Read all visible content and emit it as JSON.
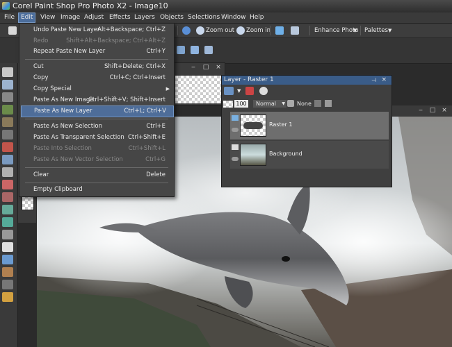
{
  "window": {
    "title": "Corel Paint Shop Pro Photo X2 - Image10"
  },
  "menubar": [
    "File",
    "Edit",
    "View",
    "Image",
    "Adjust",
    "Effects",
    "Layers",
    "Objects",
    "Selections",
    "Window",
    "Help"
  ],
  "toolbar": {
    "zoom_out": "Zoom out",
    "zoom_in": "Zoom in",
    "enhance_photo": "Enhance Photo",
    "palettes": "Palettes"
  },
  "edit_menu": {
    "items": [
      {
        "label": "Undo Paste New Layer",
        "shortcut": "Alt+Backspace; Ctrl+Z"
      },
      {
        "label": "Redo",
        "shortcut": "Shift+Alt+Backspace; Ctrl+Alt+Z"
      },
      {
        "label": "Repeat  Paste New Layer",
        "shortcut": "Ctrl+Y"
      },
      {
        "label": "Cut",
        "shortcut": "Shift+Delete; Ctrl+X"
      },
      {
        "label": "Copy",
        "shortcut": "Ctrl+C; Ctrl+Insert"
      },
      {
        "label": "Copy Special",
        "shortcut": ""
      },
      {
        "label": "Paste As New Image",
        "shortcut": "Ctrl+Shift+V; Shift+Insert"
      },
      {
        "label": "Paste As New Layer",
        "shortcut": "Ctrl+L; Ctrl+V"
      },
      {
        "label": "Paste As New Selection",
        "shortcut": "Ctrl+E"
      },
      {
        "label": "Paste As Transparent Selection",
        "shortcut": "Ctrl+Shift+E"
      },
      {
        "label": "Paste Into Selection",
        "shortcut": "Ctrl+Shift+L"
      },
      {
        "label": "Paste As New Vector Selection",
        "shortcut": "Ctrl+G"
      },
      {
        "label": "Clear",
        "shortcut": "Delete"
      },
      {
        "label": "Empty Clipboard",
        "shortcut": ""
      }
    ]
  },
  "layers_palette": {
    "title": "Layer - Raster 1",
    "opacity": "100",
    "blend_mode": "Normal",
    "mask_mode": "None",
    "layers": [
      {
        "name": "Raster 1"
      },
      {
        "name": "Background"
      }
    ]
  }
}
